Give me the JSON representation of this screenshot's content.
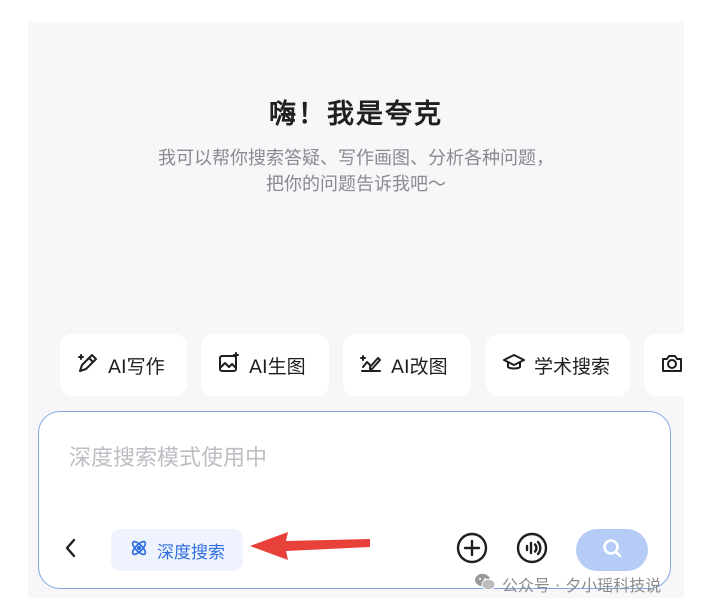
{
  "header": {
    "title": "嗨！我是夸克",
    "subtitle_line1": "我可以帮你搜索答疑、写作画图、分析各种问题，",
    "subtitle_line2": "把你的问题告诉我吧～"
  },
  "chips": [
    {
      "label": "AI写作",
      "icon": "pen-sparkle-icon"
    },
    {
      "label": "AI生图",
      "icon": "image-sparkle-icon"
    },
    {
      "label": "AI改图",
      "icon": "edit-image-icon"
    },
    {
      "label": "学术搜索",
      "icon": "graduation-cap-icon"
    },
    {
      "label": "",
      "icon": "camera-icon"
    }
  ],
  "input": {
    "placeholder": "深度搜索模式使用中"
  },
  "toolbar": {
    "mode_label": "深度搜索",
    "mode_icon": "atom-icon",
    "back_icon": "chevron-left-icon",
    "add_icon": "plus-circle-icon",
    "voice_icon": "voice-wave-icon",
    "search_icon": "search-icon"
  },
  "watermark": {
    "text": "公众号 · 夕小瑶科技说",
    "icon": "wechat-icon"
  },
  "colors": {
    "accent": "#2f6fe0",
    "search_button": "#b5cdf6",
    "input_border": "#7fa8e8",
    "arrow": "#e8413a"
  }
}
